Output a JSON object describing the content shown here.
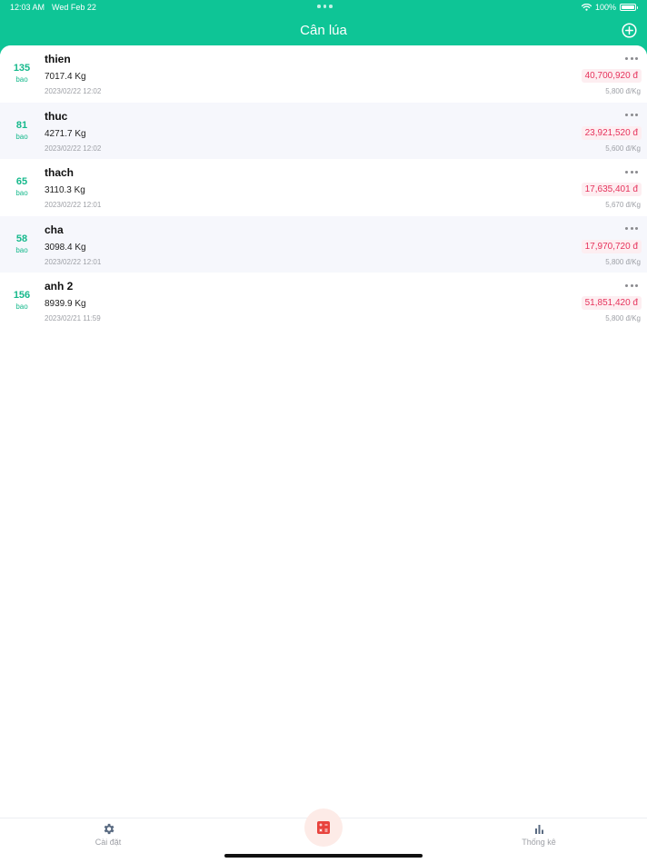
{
  "status_bar": {
    "time": "12:03 AM",
    "date": "Wed Feb 22",
    "battery": "100%",
    "battery_level": 1.0
  },
  "header": {
    "title": "Cân lúa",
    "add_icon": "plus-circle-icon"
  },
  "rows": [
    {
      "count": "135",
      "unit": "bao",
      "name": "thien",
      "weight": "7017.4 Kg",
      "date": "2023/02/22 12:02",
      "total": "40,700,920 đ",
      "price": "5,800 đ/Kg"
    },
    {
      "count": "81",
      "unit": "bao",
      "name": "thuc",
      "weight": "4271.7 Kg",
      "date": "2023/02/22 12:02",
      "total": "23,921,520 đ",
      "price": "5,600 đ/Kg"
    },
    {
      "count": "65",
      "unit": "bao",
      "name": "thach",
      "weight": "3110.3 Kg",
      "date": "2023/02/22 12:01",
      "total": "17,635,401 đ",
      "price": "5,670 đ/Kg"
    },
    {
      "count": "58",
      "unit": "bao",
      "name": "cha",
      "weight": "3098.4 Kg",
      "date": "2023/02/22 12:01",
      "total": "17,970,720 đ",
      "price": "5,800 đ/Kg"
    },
    {
      "count": "156",
      "unit": "bao",
      "name": "anh 2",
      "weight": "8939.9 Kg",
      "date": "2023/02/21 11:59",
      "total": "51,851,420 đ",
      "price": "5,800 đ/Kg"
    }
  ],
  "tabs": {
    "settings": {
      "label": "Cài đặt",
      "icon": "gear-icon"
    },
    "calculator": {
      "icon": "calculator-icon"
    },
    "stats": {
      "label": "Thống kê",
      "icon": "bar-chart-icon"
    }
  },
  "colors": {
    "header": "#0ec596",
    "count": "#16b98c",
    "total_text": "#e6335c",
    "total_bg": "#fdeef1",
    "alt_row": "#f6f7fc",
    "calc_bg": "#fdebe7",
    "calc_icon": "#e8433d",
    "muted": "#9ea0a6"
  }
}
